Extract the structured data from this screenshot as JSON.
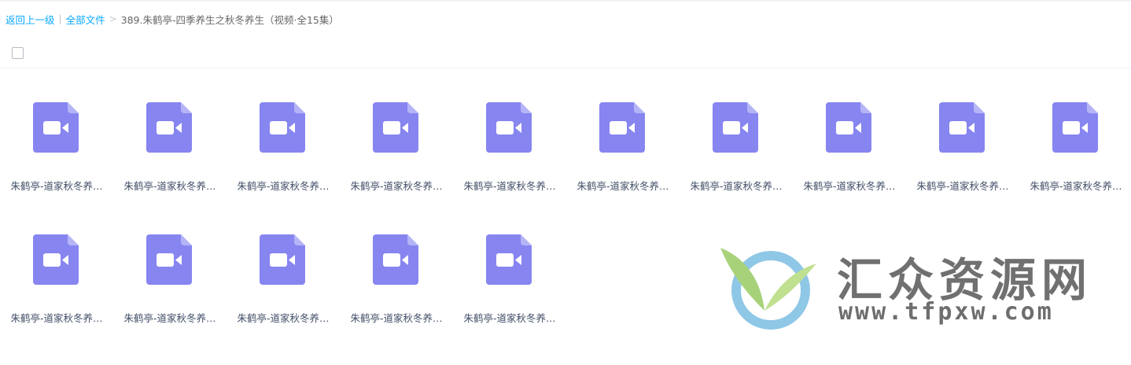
{
  "breadcrumb": {
    "back_label": "返回上一级",
    "separator_1": "|",
    "root_label": "全部文件",
    "separator_2": ">",
    "current_folder": "389.朱鹤亭-四季养生之秋冬养生（视频·全15集）"
  },
  "toolbar": {
    "select_all_checked": false
  },
  "colors": {
    "icon_fill": "#8785f0",
    "icon_fold": "#b5b4f7",
    "link": "#09aaff",
    "text": "#424e67"
  },
  "files": [
    {
      "name": "朱鹤亭-道家秋冬养…",
      "icon": "video-file-icon"
    },
    {
      "name": "朱鹤亭-道家秋冬养…",
      "icon": "video-file-icon"
    },
    {
      "name": "朱鹤亭-道家秋冬养…",
      "icon": "video-file-icon"
    },
    {
      "name": "朱鹤亭-道家秋冬养…",
      "icon": "video-file-icon"
    },
    {
      "name": "朱鹤亭-道家秋冬养…",
      "icon": "video-file-icon"
    },
    {
      "name": "朱鹤亭-道家秋冬养…",
      "icon": "video-file-icon"
    },
    {
      "name": "朱鹤亭-道家秋冬养…",
      "icon": "video-file-icon"
    },
    {
      "name": "朱鹤亭-道家秋冬养…",
      "icon": "video-file-icon"
    },
    {
      "name": "朱鹤亭-道家秋冬养…",
      "icon": "video-file-icon"
    },
    {
      "name": "朱鹤亭-道家秋冬养…",
      "icon": "video-file-icon"
    },
    {
      "name": "朱鹤亭-道家秋冬养…",
      "icon": "video-file-icon"
    },
    {
      "name": "朱鹤亭-道家秋冬养…",
      "icon": "video-file-icon"
    },
    {
      "name": "朱鹤亭-道家秋冬养…",
      "icon": "video-file-icon"
    },
    {
      "name": "朱鹤亭-道家秋冬养…",
      "icon": "video-file-icon"
    },
    {
      "name": "朱鹤亭-道家秋冬养…",
      "icon": "video-file-icon"
    }
  ],
  "watermark": {
    "title": "汇众资源网",
    "url": "www.tfpxw.com"
  }
}
